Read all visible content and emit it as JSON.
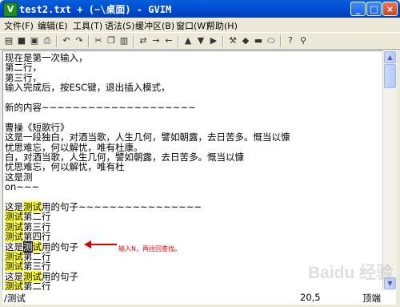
{
  "window": {
    "title": "test2.txt + (~\\桌面) - GVIM",
    "app_icon": "vim-icon",
    "controls": {
      "minimize": "_",
      "maximize": "□",
      "close": "×"
    }
  },
  "menu": [
    "文件(F)",
    "编辑(E)",
    "工具(T)",
    "语法(S)",
    "缓冲区(B)",
    "窗口(W)",
    "帮助(H)"
  ],
  "toolbar": {
    "icons": [
      "open-icon",
      "save-icon",
      "save-all-icon",
      "print-icon",
      "undo-icon",
      "redo-icon",
      "cut-icon",
      "copy-icon",
      "paste-icon",
      "find-replace-icon",
      "find-next-icon",
      "find-prev-icon",
      "load-session-icon",
      "save-session-icon",
      "run-script-icon",
      "make-icon",
      "shell-icon",
      "make-tags-icon",
      "jump-tag-icon",
      "help-icon",
      "find-help-icon"
    ]
  },
  "editor": {
    "lines": [
      {
        "segments": [
          {
            "text": "现在是第一次输入，",
            "hl": false
          }
        ]
      },
      {
        "segments": [
          {
            "text": "第二行，",
            "hl": false
          }
        ]
      },
      {
        "segments": [
          {
            "text": "第三行，",
            "hl": false
          }
        ]
      },
      {
        "segments": [
          {
            "text": "输入完成后，按ESC键，退出插入模式，",
            "hl": false
          }
        ]
      },
      {
        "segments": [
          {
            "text": "",
            "hl": false
          }
        ]
      },
      {
        "segments": [
          {
            "text": "新的内容~~~~~~~~~~~~~~~~~~~~",
            "hl": false
          }
        ]
      },
      {
        "segments": [
          {
            "text": "",
            "hl": false
          }
        ]
      },
      {
        "segments": [
          {
            "text": "曹操《短歌行》",
            "hl": false
          }
        ]
      },
      {
        "segments": [
          {
            "text": "这是一段独白，对酒当歌，人生几何，譬如朝露，去日苦多。慨当以慷",
            "hl": false
          }
        ]
      },
      {
        "segments": [
          {
            "text": "忧思难忘，何以解忧，唯有杜康。",
            "hl": false
          }
        ]
      },
      {
        "segments": [
          {
            "text": "白，对酒当歌，人生几何，譬如朝露，去日苦多。慨当以慷",
            "hl": false
          }
        ]
      },
      {
        "segments": [
          {
            "text": "忧思难忘，何以解忧，唯有杜",
            "hl": false
          }
        ]
      },
      {
        "segments": [
          {
            "text": "这是测",
            "hl": false
          }
        ]
      },
      {
        "segments": [
          {
            "text": " on~~~",
            "hl": false
          }
        ]
      },
      {
        "segments": [
          {
            "text": "",
            "hl": false
          }
        ]
      },
      {
        "segments": [
          {
            "text": "这是",
            "hl": false
          },
          {
            "text": "测试",
            "hl": true
          },
          {
            "text": "用的句子~~~~~~~~~~~~~~~~",
            "hl": false
          }
        ]
      },
      {
        "segments": [
          {
            "text": "测试",
            "hl": true
          },
          {
            "text": "第二行",
            "hl": false
          }
        ]
      },
      {
        "segments": [
          {
            "text": "测试",
            "hl": true
          },
          {
            "text": "第三行",
            "hl": false
          }
        ]
      },
      {
        "segments": [
          {
            "text": "测试",
            "hl": true
          },
          {
            "text": "第四行",
            "hl": false
          }
        ]
      },
      {
        "segments": [
          {
            "text": "这是",
            "hl": false
          },
          {
            "text": "测",
            "hl": true,
            "cursor": true
          },
          {
            "text": "试",
            "hl": true
          },
          {
            "text": "用的句子",
            "hl": false
          }
        ]
      },
      {
        "segments": [
          {
            "text": "测试",
            "hl": true
          },
          {
            "text": "第二行",
            "hl": false
          }
        ]
      },
      {
        "segments": [
          {
            "text": "测试",
            "hl": true
          },
          {
            "text": "第三行",
            "hl": false
          }
        ]
      },
      {
        "segments": [
          {
            "text": "这是",
            "hl": false
          },
          {
            "text": "测试",
            "hl": true
          },
          {
            "text": "用的句子",
            "hl": false
          }
        ]
      },
      {
        "segments": [
          {
            "text": "测试",
            "hl": true
          },
          {
            "text": "第二行",
            "hl": false
          }
        ]
      }
    ]
  },
  "annotation": {
    "text": "输入N，再往回查找。",
    "color": "#e00000"
  },
  "statusbar": {
    "command": "/测试",
    "position": "20,5",
    "scroll": "顶端"
  },
  "watermark": "Baidu 经验",
  "colors": {
    "search_highlight": "#ffff3c",
    "titlebar": "#0051d6"
  }
}
